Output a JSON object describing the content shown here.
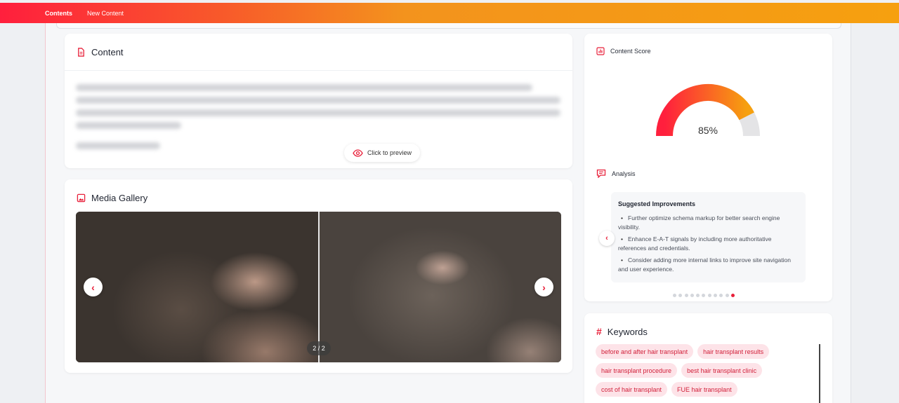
{
  "nav": {
    "tabs": [
      "Contents",
      "New Content"
    ]
  },
  "content_card": {
    "title": "Content",
    "preview_label": "Click to preview"
  },
  "media_card": {
    "title": "Media Gallery",
    "counter": "2 / 2",
    "prev": "‹",
    "next": "›"
  },
  "score_card": {
    "title": "Content Score",
    "score": 85,
    "score_label": "85%"
  },
  "analysis": {
    "title": "Analysis",
    "heading": "Suggested Improvements",
    "items": [
      "Further optimize schema markup for better search engine visibility.",
      "Enhance E-A-T signals by including more authoritative references and credentials.",
      "Consider adding more internal links to improve site navigation and user experience."
    ],
    "prev": "‹",
    "page_count": 11,
    "active_page": 11
  },
  "keywords": {
    "title": "Keywords",
    "rows": [
      [
        "before and after hair transplant",
        "hair transplant results"
      ],
      [
        "hair transplant procedure",
        "best hair transplant clinic"
      ],
      [
        "cost of hair transplant",
        "FUE hair transplant"
      ]
    ]
  },
  "colors": {
    "accent": "#e8203a",
    "gauge_start": "#ff1f3d",
    "gauge_end": "#f6a00f",
    "gauge_track": "#e4e4e6"
  }
}
